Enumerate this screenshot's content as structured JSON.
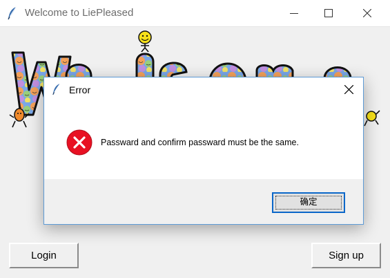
{
  "window": {
    "title": "Welcome to LiePleased",
    "icon": "feather-icon"
  },
  "banner": {
    "text": "Welcome",
    "style": "smiley-patterned bubble letters with dancing smiley mascots"
  },
  "dialog": {
    "title": "Error",
    "message": "Passward and confirm passward must be the same.",
    "ok_label": "确定",
    "icon": "error-icon",
    "icon_color": "#e81123"
  },
  "buttons": {
    "login_label": "Login",
    "signup_label": "Sign up"
  },
  "colors": {
    "dialog_border": "#5d9bd6",
    "focus_border": "#0b67c9",
    "window_bg": "#f0f0f0"
  }
}
